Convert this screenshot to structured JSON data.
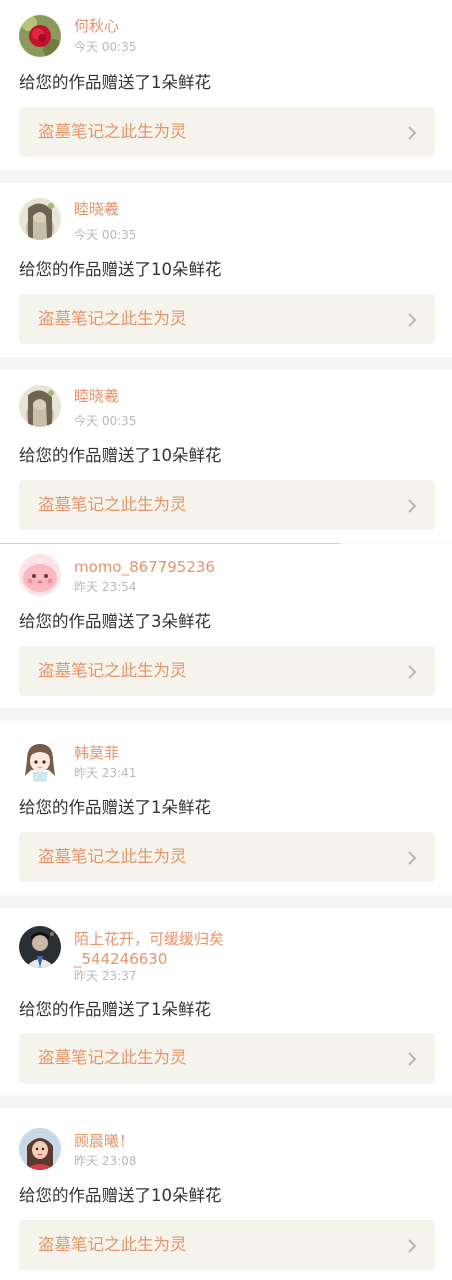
{
  "notifications": [
    {
      "username": "何秋心",
      "time": "今天 00:35",
      "message": "给您的作品赠送了1朵鲜花",
      "work_title": "盗墓笔记之此生为灵",
      "avatar_icon": "red-rose-avatar"
    },
    {
      "username": "睦晓羲",
      "time": "今天 00:35",
      "message": "给您的作品赠送了10朵鲜花",
      "work_title": "盗墓笔记之此生为灵",
      "avatar_icon": "ancient-style-girl-avatar"
    },
    {
      "username": "睦晓羲",
      "time": "今天 00:35",
      "message": "给您的作品赠送了10朵鲜花",
      "work_title": "盗墓笔记之此生为灵",
      "avatar_icon": "ancient-style-girl-avatar"
    },
    {
      "username": "momo_867795236",
      "time": "昨天 23:54",
      "message": "给您的作品赠送了3朵鲜花",
      "work_title": "盗墓笔记之此生为灵",
      "avatar_icon": "pink-blob-avatar"
    },
    {
      "username": "韩莫菲",
      "time": "昨天 23:41",
      "message": "给您的作品赠送了1朵鲜花",
      "work_title": "盗墓笔记之此生为灵",
      "avatar_icon": "cartoon-girl-avatar"
    },
    {
      "username": "陌上花开，可缓缓归矣_544246630",
      "time": "昨天 23:37",
      "message": "给您的作品赠送了1朵鲜花",
      "work_title": "盗墓笔记之此生为灵",
      "avatar_icon": "dark-portrait-avatar"
    },
    {
      "username": "顾晨曦！",
      "time": "昨天 23:08",
      "message": "给您的作品赠送了10朵鲜花",
      "work_title": "盗墓笔记之此生为灵",
      "avatar_icon": "girl-photo-avatar"
    }
  ],
  "colors": {
    "accent": "#e7946a",
    "message_text": "#333333",
    "time_text": "#b9b9b9",
    "link_background": "#f5f4ec",
    "page_background": "#f5f5f5"
  }
}
